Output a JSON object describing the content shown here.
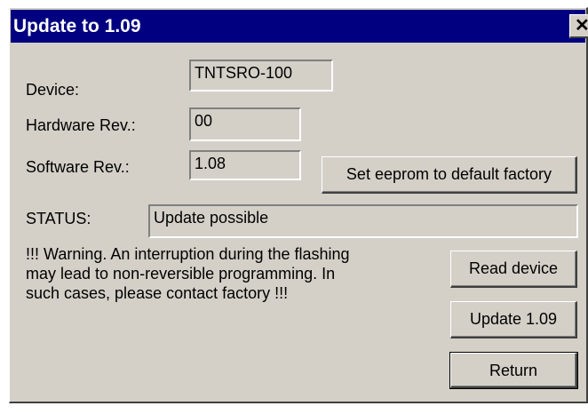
{
  "window": {
    "title": "Update to 1.09",
    "close_glyph": "✕"
  },
  "device": {
    "label": "Device:",
    "value": "TNTSRO-100"
  },
  "hardware": {
    "label": "Hardware Rev.:",
    "value": "00"
  },
  "software": {
    "label": "Software Rev.:",
    "value": "1.08"
  },
  "status": {
    "label": "STATUS:",
    "value": "Update possible"
  },
  "warning": {
    "lines": [
      "!!! Warning. An interruption during the flashing",
      "may lead to non-reversible programming. In",
      "such cases, please contact factory !!!"
    ]
  },
  "buttons": {
    "set_default": "Set eeprom to default factory",
    "read_device": "Read device",
    "update": "Update 1.09",
    "return": "Return"
  }
}
